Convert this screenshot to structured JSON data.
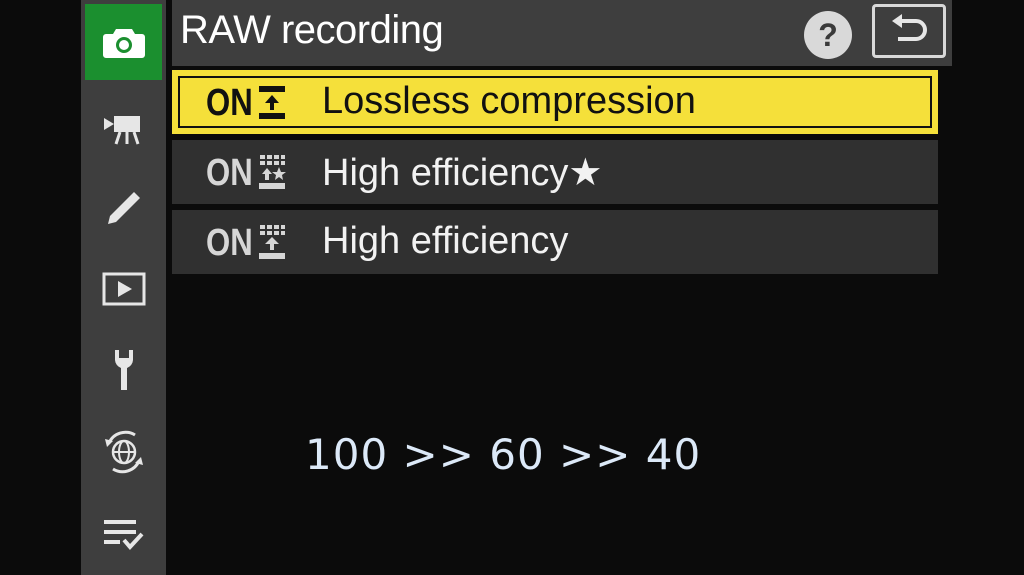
{
  "header": {
    "title": "RAW recording",
    "help_label": "?"
  },
  "sidebar": {
    "tabs": [
      {
        "icon": "camera-icon",
        "active": true
      },
      {
        "icon": "video-camera-icon",
        "active": false
      },
      {
        "icon": "pencil-icon",
        "active": false
      },
      {
        "icon": "playback-icon",
        "active": false
      },
      {
        "icon": "wrench-icon",
        "active": false
      },
      {
        "icon": "network-icon",
        "active": false
      },
      {
        "icon": "my-menu-icon",
        "active": false
      }
    ]
  },
  "menu": {
    "items": [
      {
        "on": "ON",
        "label": "Lossless compression",
        "icon": "lossless-compression-icon",
        "selected": true
      },
      {
        "on": "ON",
        "label": "High efficiency★",
        "icon": "high-efficiency-star-icon",
        "selected": false
      },
      {
        "on": "ON",
        "label": "High efficiency",
        "icon": "high-efficiency-icon",
        "selected": false
      }
    ]
  },
  "overlay": {
    "text": "100 >> 60 >> 40"
  },
  "colors": {
    "active_tab": "#1b8f2f",
    "selection": "#f5e03a",
    "panel": "#3e3e3e",
    "row": "#303030",
    "overlay_text": "#dce9f8"
  }
}
